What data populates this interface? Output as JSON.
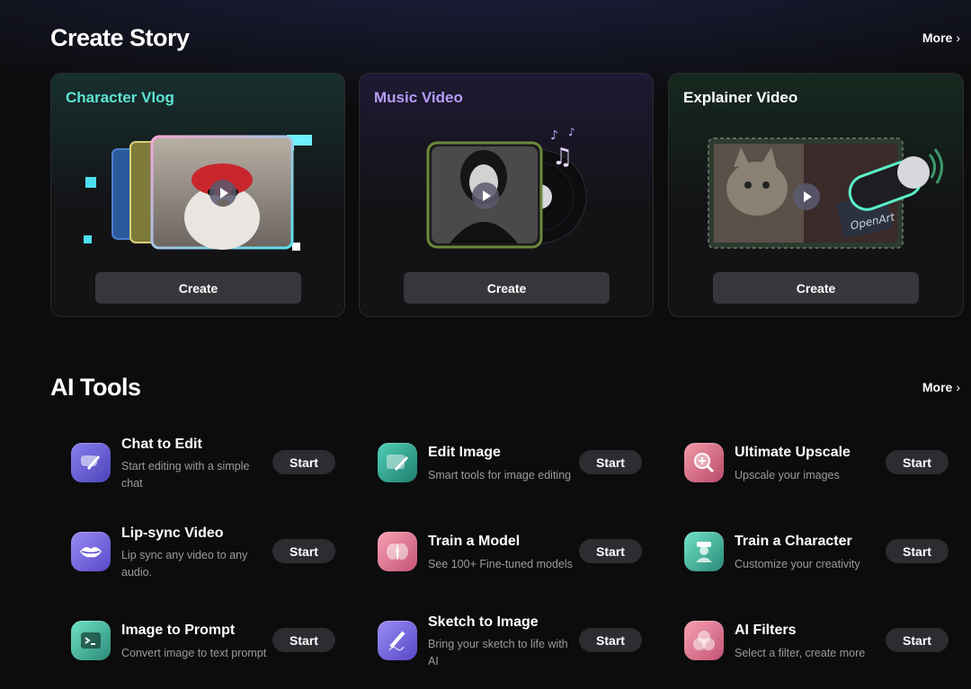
{
  "create_story": {
    "title": "Create Story",
    "more_label": "More",
    "cards": [
      {
        "title": "Character Vlog",
        "button": "Create"
      },
      {
        "title": "Music Video",
        "button": "Create"
      },
      {
        "title": "Explainer Video",
        "button": "Create"
      }
    ],
    "mic_brand": "OpenArt"
  },
  "ai_tools": {
    "title": "AI Tools",
    "more_label": "More",
    "start_label": "Start",
    "tools": [
      {
        "title": "Chat to Edit",
        "desc": "Start editing with a simple chat",
        "icon": "chat-edit-icon"
      },
      {
        "title": "Edit Image",
        "desc": "Smart tools for image editing",
        "icon": "edit-image-icon"
      },
      {
        "title": "Ultimate Upscale",
        "desc": "Upscale your images",
        "icon": "upscale-icon"
      },
      {
        "title": "Lip-sync Video",
        "desc": "Lip sync any video to any audio.",
        "icon": "lips-icon"
      },
      {
        "title": "Train a Model",
        "desc": "See 100+ Fine-tuned models",
        "icon": "brain-icon"
      },
      {
        "title": "Train a Character",
        "desc": "Customize your creativity",
        "icon": "character-icon"
      },
      {
        "title": "Image to Prompt",
        "desc": "Convert image to text prompt",
        "icon": "terminal-icon"
      },
      {
        "title": "Sketch to Image",
        "desc": "Bring your sketch to life with AI",
        "icon": "pencil-icon"
      },
      {
        "title": "AI Filters",
        "desc": "Select a filter, create more",
        "icon": "filters-icon"
      }
    ]
  }
}
